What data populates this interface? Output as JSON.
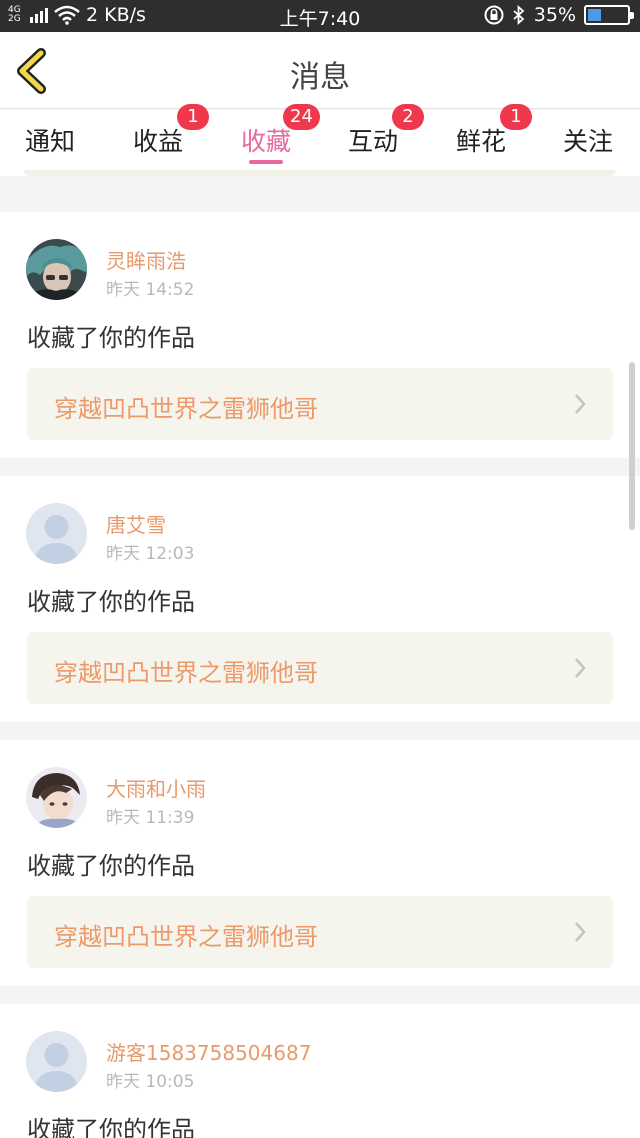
{
  "status_bar": {
    "network": "4G 2G",
    "speed": "2 KB/s",
    "time": "上午7:40",
    "battery": "35%",
    "battery_level": 0.35
  },
  "header": {
    "title": "消息",
    "back_icon": "chevron-left-icon"
  },
  "tabs": [
    {
      "label": "通知",
      "badge": ""
    },
    {
      "label": "收益",
      "badge": "1"
    },
    {
      "label": "收藏",
      "badge": "24",
      "active": true
    },
    {
      "label": "互动",
      "badge": "2"
    },
    {
      "label": "鲜花",
      "badge": "1"
    },
    {
      "label": "关注",
      "badge": ""
    }
  ],
  "messages": [
    {
      "user": "灵眸雨浩",
      "time": "昨天 14:52",
      "action": "收藏了你的作品",
      "work": "穿越凹凸世界之雷狮他哥"
    },
    {
      "user": "唐艾雪",
      "time": "昨天 12:03",
      "action": "收藏了你的作品",
      "work": "穿越凹凸世界之雷狮他哥"
    },
    {
      "user": "大雨和小雨",
      "time": "昨天 11:39",
      "action": "收藏了你的作品",
      "work": "穿越凹凸世界之雷狮他哥"
    },
    {
      "user": "游客1583758504687",
      "time": "昨天 10:05",
      "action": "收藏了你的作品",
      "work": ""
    }
  ],
  "colors": {
    "accent": "#e8699f",
    "badge": "#f0384c",
    "username": "#e89a6c",
    "work_title": "#ec9a6a",
    "status_bar": "#2e2e2e"
  }
}
